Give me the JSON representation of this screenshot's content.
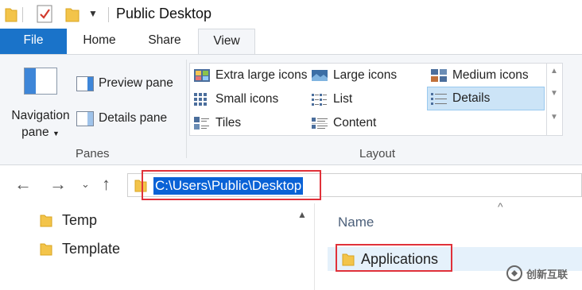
{
  "window": {
    "title": "Public Desktop"
  },
  "ribbon": {
    "tabs": [
      {
        "label": "File"
      },
      {
        "label": "Home"
      },
      {
        "label": "Share"
      },
      {
        "label": "View"
      }
    ],
    "panes": {
      "group_label": "Panes",
      "navigation_pane_line1": "Navigation",
      "navigation_pane_line2": "pane",
      "preview_pane": "Preview pane",
      "details_pane": "Details pane"
    },
    "layout": {
      "group_label": "Layout",
      "options": [
        {
          "label": "Extra large icons",
          "icon": "extra-large-icons-icon"
        },
        {
          "label": "Large icons",
          "icon": "large-icons-icon"
        },
        {
          "label": "Medium icons",
          "icon": "medium-icons-icon"
        },
        {
          "label": "Small icons",
          "icon": "small-icons-icon"
        },
        {
          "label": "List",
          "icon": "list-icon"
        },
        {
          "label": "Details",
          "icon": "details-icon"
        },
        {
          "label": "Tiles",
          "icon": "tiles-icon"
        },
        {
          "label": "Content",
          "icon": "content-icon"
        }
      ],
      "selected": "Details"
    }
  },
  "address_bar": {
    "path": "C:\\Users\\Public\\Desktop"
  },
  "nav_tree": {
    "items": [
      {
        "label": "Temp"
      },
      {
        "label": "Template"
      }
    ]
  },
  "content": {
    "column_header": "Name",
    "items": [
      {
        "label": "Applications",
        "type": "folder"
      }
    ]
  },
  "colors": {
    "accent": "#1a73c9",
    "selection": "#0a62d6",
    "highlight_box": "#e0313a"
  },
  "watermark": {
    "text": "创新互联"
  }
}
